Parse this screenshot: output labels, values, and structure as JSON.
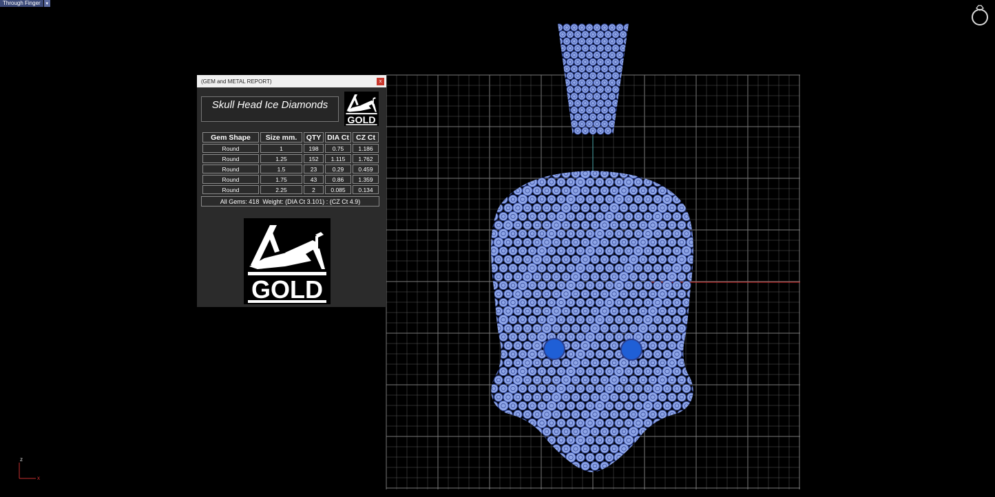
{
  "viewport": {
    "tab_label": "Through Finger",
    "tab_dropdown_icon": "chevron-down-icon",
    "ring_icon": "ring-icon",
    "axis": {
      "z_label": "z",
      "x_label": "x"
    }
  },
  "colors": {
    "background": "#000000",
    "grid": "#5a5a5a",
    "gem_fill": "#8fa6e8",
    "gem_stroke": "#2a3f90",
    "eye_gem": "#1f5fd6",
    "x_axis_line": "#d02020",
    "bail_link": "#4aa3a8"
  },
  "report": {
    "window_title": "(GEM and METAL REPORT)",
    "close_label": "x",
    "piece_name": "Skull Head Ice Diamonds",
    "logo_text": "GOLD",
    "columns": [
      "Gem Shape",
      "Size mm.",
      "QTY",
      "DIA Ct",
      "CZ Ct"
    ],
    "rows": [
      [
        "Round",
        "1",
        "198",
        "0.75",
        "1.186"
      ],
      [
        "Round",
        "1.25",
        "152",
        "1.115",
        "1.762"
      ],
      [
        "Round",
        "1.5",
        "23",
        "0.29",
        "0.459"
      ],
      [
        "Round",
        "1.75",
        "43",
        "0.86",
        "1.359"
      ],
      [
        "Round",
        "2.25",
        "2",
        "0.085",
        "0.134"
      ]
    ],
    "summary": "All Gems: 418  Weight: (DIA Ct 3.101) : (CZ Ct 4.9)"
  }
}
